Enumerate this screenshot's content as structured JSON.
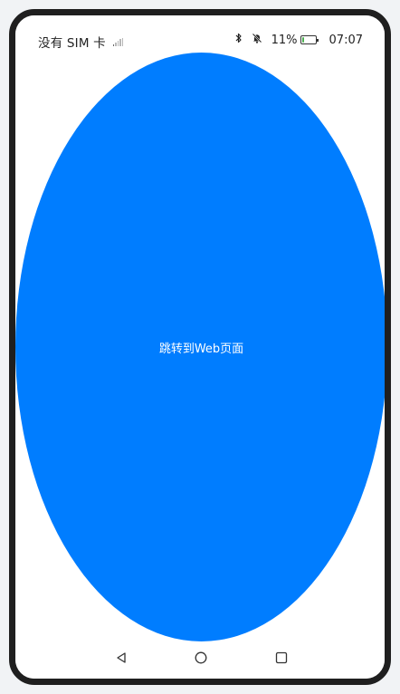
{
  "status_bar": {
    "carrier": "没有 SIM 卡",
    "signal_icon": "signal-none-icon",
    "bluetooth_icon": "bluetooth-icon",
    "mute_icon": "bell-off-icon",
    "battery_percent": "11%",
    "battery_level": 0.11,
    "time": "07:07"
  },
  "main": {
    "button_label": "跳转到Web页面",
    "button_color": "#007dff"
  },
  "nav_bar": {
    "back_icon": "triangle-back-icon",
    "home_icon": "circle-home-icon",
    "recent_icon": "square-recent-icon"
  }
}
